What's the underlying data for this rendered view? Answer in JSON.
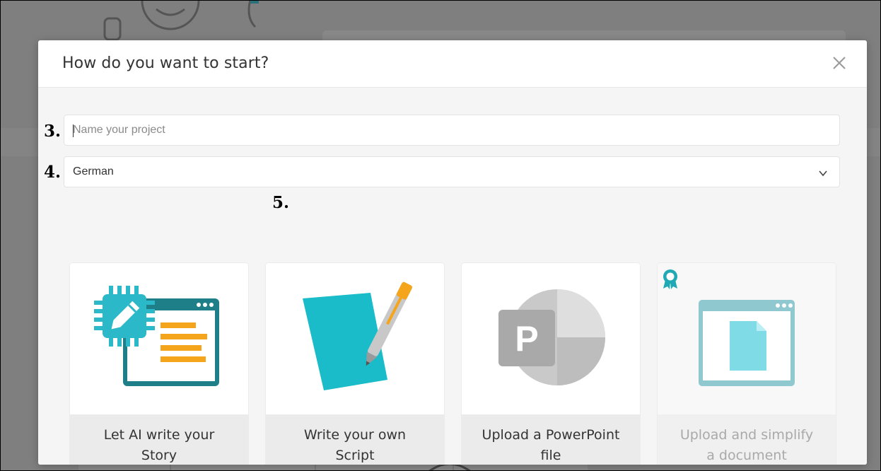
{
  "modal": {
    "title": "How do you want to start?"
  },
  "form": {
    "name_input": {
      "placeholder": "Name your project",
      "value": ""
    },
    "language_select": {
      "selected": "German"
    }
  },
  "annotations": {
    "step_name": "3.",
    "step_language": "4.",
    "step_options": "5."
  },
  "options": [
    {
      "label": "Let AI write your Story",
      "icon": "ai-chip-icon",
      "enabled": true
    },
    {
      "label": "Write your own Script",
      "icon": "pen-paper-icon",
      "enabled": true
    },
    {
      "label": "Upload a PowerPoint file",
      "icon": "powerpoint-icon",
      "enabled": true
    },
    {
      "label": "Upload and simplify a document",
      "icon": "document-window-icon",
      "enabled": false,
      "badge": "premium-ribbon-icon"
    }
  ],
  "colors": {
    "accent_teal": "#2bb8c8",
    "accent_orange": "#f5a51b",
    "overlay": "#7f7f7f"
  }
}
